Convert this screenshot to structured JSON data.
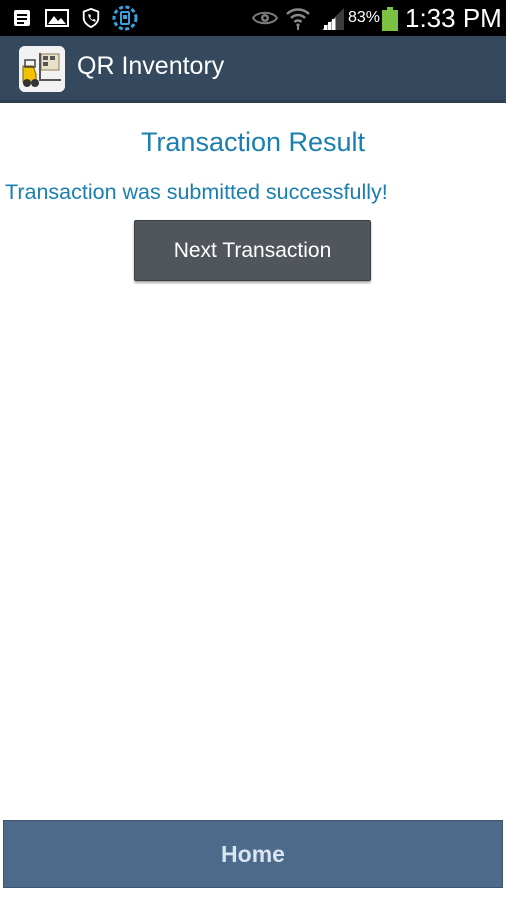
{
  "status_bar": {
    "battery_percent": "83%",
    "battery_level": 0.83,
    "time": "1:33 PM",
    "icons": [
      "notes-icon",
      "image-icon",
      "shield-phone-icon",
      "circuit-gear-icon",
      "eye-icon",
      "wifi-icon",
      "signal-icon",
      "battery-icon"
    ]
  },
  "app_bar": {
    "title": "QR Inventory",
    "icon": "forklift-icon"
  },
  "content": {
    "title": "Transaction Result",
    "message": "Transaction was submitted successfully!",
    "next_button_label": "Next Transaction"
  },
  "footer": {
    "home_label": "Home"
  },
  "colors": {
    "status_bar": "#000000",
    "app_bar": "#34495e",
    "accent_text": "#1a7fb0",
    "button": "#50565c",
    "footer": "#4d6a8a",
    "battery": "#7bc142"
  }
}
